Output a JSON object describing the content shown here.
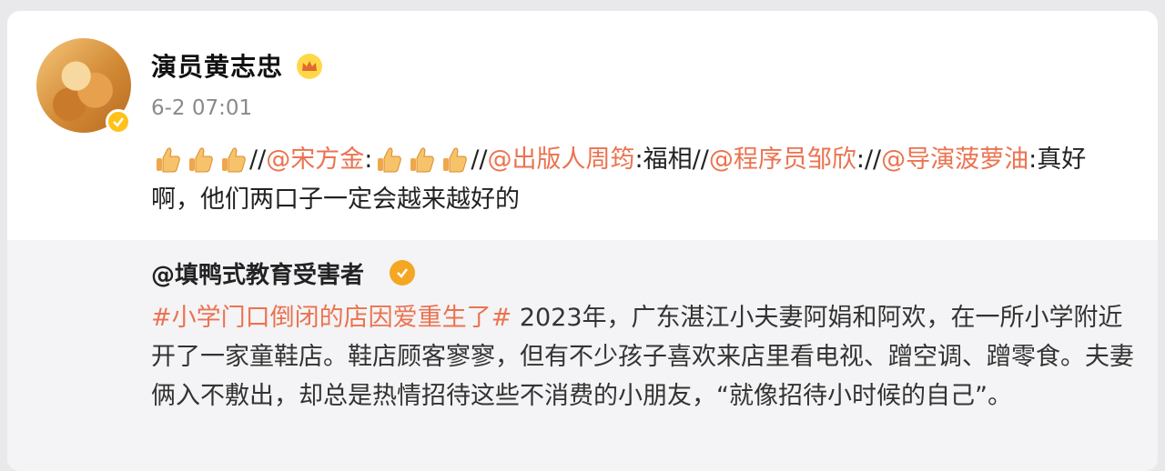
{
  "post": {
    "author": "演员黄志忠",
    "time": "6-2 07:01",
    "content": {
      "chain": [
        {
          "mention": "@宋方金",
          "sep": ":",
          "comment": ""
        },
        {
          "mention": "@出版人周筠",
          "sep": ":",
          "comment": "福相"
        },
        {
          "mention": "@程序员邹欣",
          "sep": ":",
          "comment": ""
        },
        {
          "mention": "@导演菠萝油",
          "sep": ":",
          "comment": "真好啊，他们两口子一定会越来越好的"
        }
      ],
      "repost_separator": "//",
      "emoji": "thumbs-up-icon"
    }
  },
  "repost": {
    "author": "@填鸭式教育受害者",
    "hashtag": "#小学门口倒闭的店因爱重生了#",
    "text": " 2023年，广东湛江小夫妻阿娟和阿欢，在一所小学附近开了一家童鞋店。鞋店顾客寥寥，但有不少孩子喜欢来店里看电视、蹭空调、蹭零食。夫妻俩入不敷出，却总是热情招待这些不消费的小朋友，“就像招待小时候的自己”。"
  },
  "colors": {
    "accent": "#eb7350",
    "verified": "#ffc21a",
    "badge": "#f5a623"
  }
}
